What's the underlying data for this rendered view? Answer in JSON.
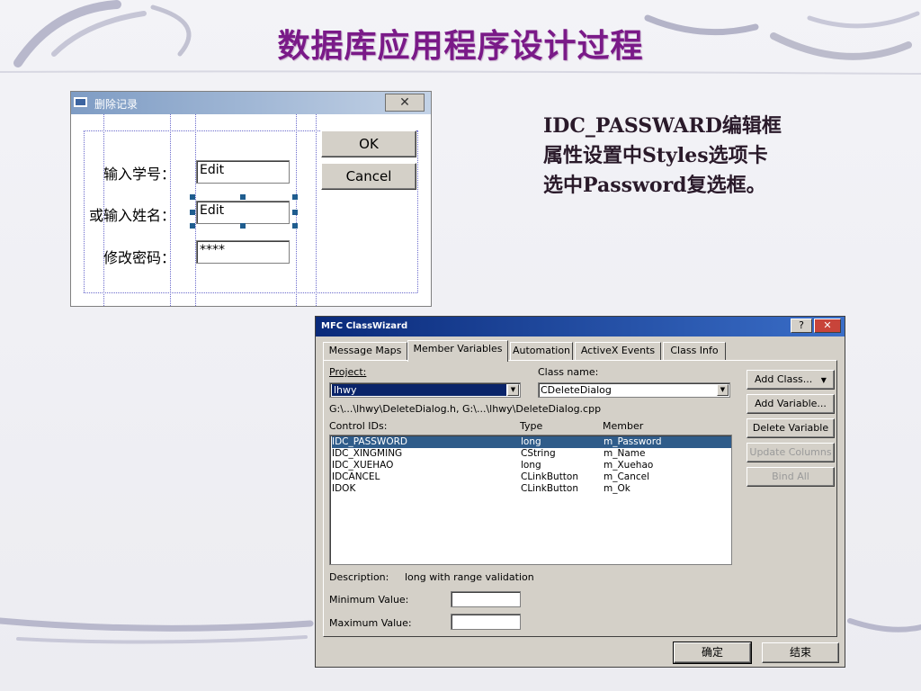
{
  "slide": {
    "title": "数据库应用程序设计过程",
    "note_lines": [
      "IDC_PASSWARD编辑框",
      "属性设置中Styles选项卡",
      "选中Password复选框。"
    ]
  },
  "dialog_editor": {
    "title": "删除记录",
    "close_glyph": "✕",
    "labels": [
      "输入学号：",
      "或输入姓名：",
      "修改密码："
    ],
    "edits": [
      "Edit",
      "Edit",
      "****"
    ],
    "ok_label": "OK",
    "cancel_label": "Cancel"
  },
  "classwizard": {
    "title": "MFC ClassWizard",
    "help_glyph": "?",
    "close_glyph": "✕",
    "tabs": [
      "Message Maps",
      "Member Variables",
      "Automation",
      "ActiveX Events",
      "Class Info"
    ],
    "project_label": "Project:",
    "project_value": "lhwy",
    "class_name_label": "Class name:",
    "class_name_value": "CDeleteDialog",
    "file_path": "G:\\...\\lhwy\\DeleteDialog.h, G:\\...\\lhwy\\DeleteDialog.cpp",
    "columns": [
      "Control IDs:",
      "Type",
      "Member"
    ],
    "rows": [
      {
        "id": "IDC_PASSWORD",
        "type": "long",
        "member": "m_Password"
      },
      {
        "id": "IDC_XINGMING",
        "type": "CString",
        "member": "m_Name"
      },
      {
        "id": "IDC_XUEHAO",
        "type": "long",
        "member": "m_Xuehao"
      },
      {
        "id": "IDCANCEL",
        "type": "CLinkButton",
        "member": "m_Cancel"
      },
      {
        "id": "IDOK",
        "type": "CLinkButton",
        "member": "m_Ok"
      }
    ],
    "side_buttons": [
      "Add Class...",
      "Add Variable...",
      "Delete Variable",
      "Update Columns",
      "Bind All"
    ],
    "description_label": "Description:",
    "description_value": "long with range validation",
    "min_label": "Minimum Value:",
    "max_label": "Maximum Value:",
    "ok_button": "确定",
    "close_button": "结束"
  }
}
